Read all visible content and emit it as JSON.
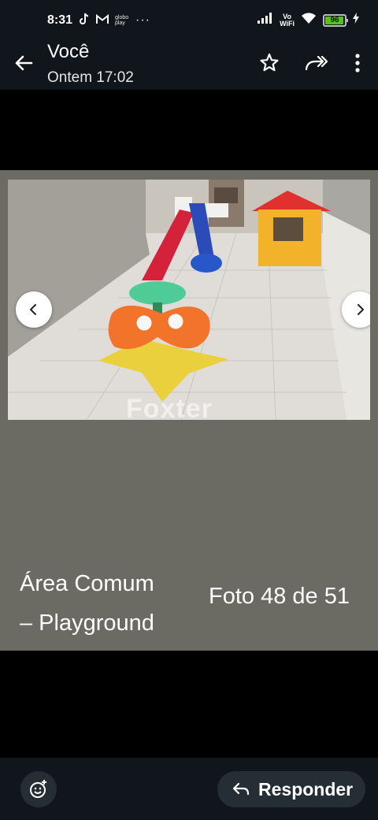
{
  "status_bar": {
    "time": "8:31",
    "notif_icons": [
      "tiktok-icon",
      "gmail-icon",
      "globoplay-icon",
      "more-dots-icon"
    ],
    "globoplay_text": "globo play",
    "more_dots": "···",
    "vowifi_top": "Vo",
    "vowifi_bottom": "WiFi",
    "battery": "96",
    "battery_level": 0.96,
    "colors": {
      "battery": "#55c21b",
      "bar_bg": "#10161c"
    }
  },
  "header": {
    "sender": "Você",
    "timestamp": "Ontem 17:02",
    "actions": [
      "back-arrow-icon",
      "star-icon",
      "forward-all-icon",
      "more-vert-icon"
    ]
  },
  "photo": {
    "watermark": "Foxter",
    "caption_line1": "Área Comum",
    "caption_line2": "– Playground",
    "counter": "Foto 48 de 51",
    "nav": [
      "chevron-left-icon",
      "chevron-right-icon"
    ]
  },
  "bottom": {
    "emoji_icon": "add-reaction-icon",
    "reply_icon": "reply-arrow-icon",
    "reply_label": "Responder"
  }
}
